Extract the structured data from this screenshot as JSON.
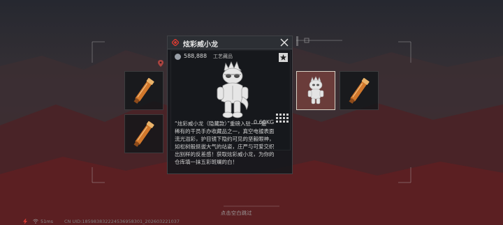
{
  "item": {
    "name": "炫彩威小龙",
    "price": "588,888",
    "category": "工艺藏品",
    "weight": "0.60KG",
    "description_lines": [
      "“炫彩威小龙（隐藏款）”重磅入驻——最",
      "稀有的干员手办收藏品之一，真空电镀表面",
      "流光溢彩，护目镜下隐约可见的坚毅眼神，",
      "如松树般挺拔大气的站姿，庄严与可爱交织",
      "出别样的反差感！获取炫彩威小龙，为你的",
      "仓库填一抹五彩斑斓的白！"
    ]
  },
  "footer": {
    "hint": "点击空白跳过",
    "signal": "51ms",
    "uid": "CN UID:1859838322245369583​01_202603221037"
  },
  "icons": [
    "red-diamond-icon",
    "close-icon",
    "coin-icon",
    "star-icon",
    "grid-icon",
    "wifi-icon",
    "lightning-icon",
    "map-pin-icon"
  ],
  "colors": {
    "accent_red": "#d43a32",
    "selected_card": "#6a3c3a"
  }
}
